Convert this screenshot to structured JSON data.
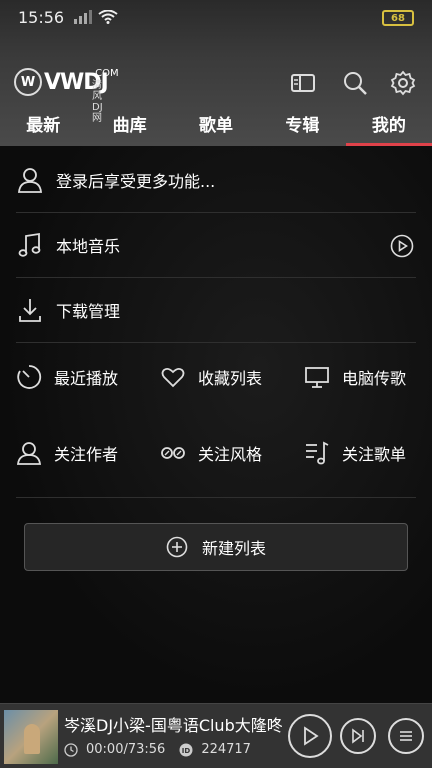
{
  "status_bar": {
    "time": "15:56",
    "battery": "68"
  },
  "header": {
    "logo_mark": "W",
    "logo_brand": "VWDJ",
    "logo_com": ".COM",
    "logo_subtitle": "清风DJ网",
    "icons": [
      "player-queue-icon",
      "search-icon",
      "settings-icon"
    ]
  },
  "tabs": [
    {
      "label": "最新",
      "active": false
    },
    {
      "label": "曲库",
      "active": false
    },
    {
      "label": "歌单",
      "active": false
    },
    {
      "label": "专辑",
      "active": false
    },
    {
      "label": "我的",
      "active": true
    }
  ],
  "menu": {
    "login": {
      "label": "登录后享受更多功能...",
      "icon": "user-icon"
    },
    "local_music": {
      "label": "本地音乐",
      "icon": "music-note-icon",
      "action_icon": "play-circle-icon"
    },
    "downloads": {
      "label": "下载管理",
      "icon": "download-icon"
    }
  },
  "shortcuts": [
    [
      {
        "label": "最近播放",
        "icon": "recent-icon"
      },
      {
        "label": "收藏列表",
        "icon": "heart-icon"
      },
      {
        "label": "电脑传歌",
        "icon": "monitor-icon"
      }
    ],
    [
      {
        "label": "关注作者",
        "icon": "person-icon"
      },
      {
        "label": "关注风格",
        "icon": "style-icon"
      },
      {
        "label": "关注歌单",
        "icon": "playlist-icon"
      }
    ]
  ],
  "new_playlist": {
    "label": "新建列表",
    "icon": "plus-circle-icon"
  },
  "player": {
    "track": "岑溪DJ小梁-国粤语Club大隆咚",
    "position": "00:00/73:56",
    "id": "224717"
  },
  "colors": {
    "accent": "#e0424a"
  }
}
